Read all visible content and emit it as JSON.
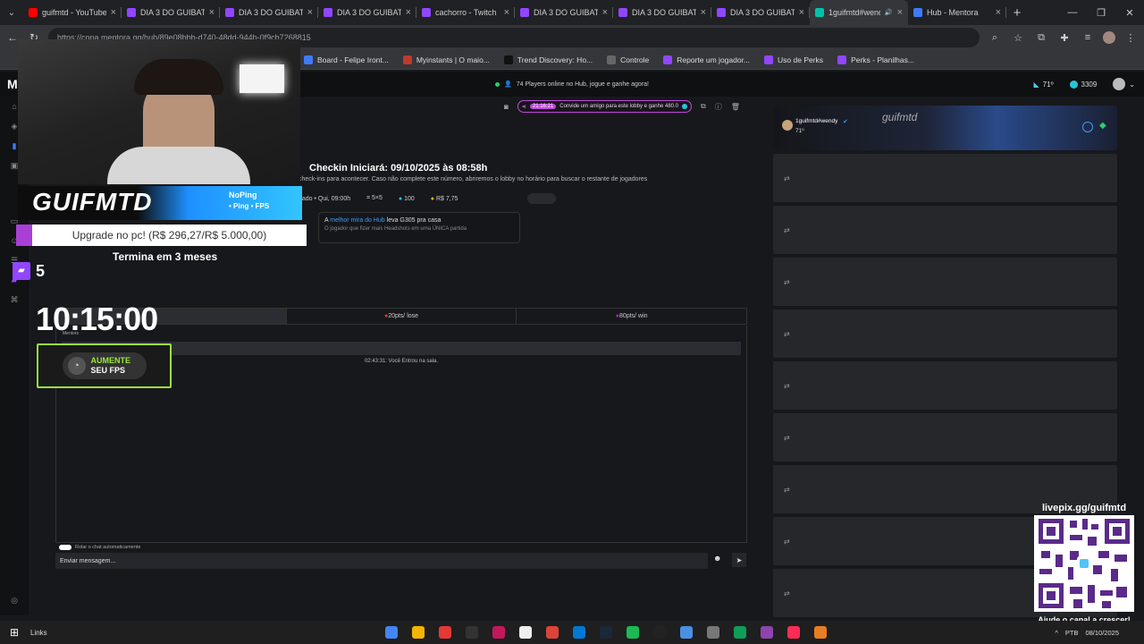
{
  "tabs": [
    {
      "title": "guifmtd - YouTube",
      "color": "#ff0000"
    },
    {
      "title": "DIA 3 DO GUIBAT",
      "color": "#9146ff"
    },
    {
      "title": "DIA 3 DO GUIBAT",
      "color": "#9146ff"
    },
    {
      "title": "DIA 3 DO GUIBAT",
      "color": "#9146ff"
    },
    {
      "title": "cachorro - Twitch",
      "color": "#9146ff"
    },
    {
      "title": "DIA 3 DO GUIBAT",
      "color": "#9146ff"
    },
    {
      "title": "DIA 3 DO GUIBAT",
      "color": "#9146ff"
    },
    {
      "title": "DIA 3 DO GUIBAT",
      "color": "#9146ff"
    },
    {
      "title": "1guifmtd#wendy",
      "color": "#00c2a8",
      "active": true
    },
    {
      "title": "Hub - Mentora",
      "color": "#3e7bfa"
    }
  ],
  "address": {
    "url": "https://copa.mentora.gg/hub/89e08bbb-d740-48dd-944b-0f9cb7268815"
  },
  "bookmarks": [
    "Board - Felipe Iront...",
    "Myinstants | O maio...",
    "Trend Discovery: Ho...",
    "Controle",
    "Reporte um jogador...",
    "Uso de Perks",
    "Perks - Planilhas..."
  ],
  "bookmark_colors": [
    "#3e7bfa",
    "#c0392b",
    "#111",
    "#666",
    "#9146ff",
    "#9146ff",
    "#9146ff"
  ],
  "banner": {
    "text": "74 Players online no Hub, jogue e ganhe agora!"
  },
  "header_stats": {
    "ping": "71º",
    "coins": "3309"
  },
  "invite": {
    "timer": "21:16:21",
    "text": "Convide um amigo para este lobby e ganhe 480.0"
  },
  "checkin": {
    "title": "Checkin Iniciará: 09/10/2025 às 08:58h",
    "subtitle": "check-ins para acontecer. Caso não complete este número, abriremos o lobby no horário para buscar o restante de jogadores"
  },
  "lobby": {
    "date": "dado • Qui, 09:00h",
    "mode": "5×5",
    "players": "100",
    "prize": "R$ 7,75"
  },
  "promo": {
    "prefix": "A ",
    "highlight": "melhor mira do Hub",
    "suffix": " leva G305 pra casa",
    "sub": "O jogador que fizer mais Headshots em uma ÚNICA partida"
  },
  "score_tabs": {
    "col2": "20pts/ lose",
    "col3": "80pts/ win"
  },
  "chat": {
    "log": "02:43:31: Você Entrou na sala.",
    "autoscroll": "Rolar o chat automaticamente",
    "placeholder": "Enviar mensagem..."
  },
  "player_card": {
    "name": "1guifmtd#wendy",
    "rating": "71º",
    "brand": "guifmtd"
  },
  "overlay": {
    "nop_line1": "NoPing",
    "nop_line2": "• Ping • FPS",
    "goal": "Upgrade no pc! (R$ 296,27/R$ 5.000,00)",
    "ends": "Termina em 3 meses",
    "subs": "5",
    "clock": "10:15:00",
    "fps_line1": "AUMENTE",
    "fps_line2": "SEU FPS",
    "logo": "GUIFMTD",
    "livepix": "livepix.gg/guifmtd",
    "support": "Ajude o canal a crescer!",
    "mentors_label": "Mentors"
  },
  "taskbar": {
    "links": "Links",
    "lang": "PTB",
    "date": "08/10/2025"
  },
  "taskbar_apps": [
    "#4285f4",
    "#f4b400",
    "#e53935",
    "#333",
    "#c2185b",
    "#eee",
    "#db4437",
    "#0078d4",
    "#1b2838",
    "#1db954",
    "#222",
    "#4a90e2",
    "#777",
    "#0f9d58",
    "#8e44ad",
    "#fe2c55",
    "#e67e22"
  ]
}
